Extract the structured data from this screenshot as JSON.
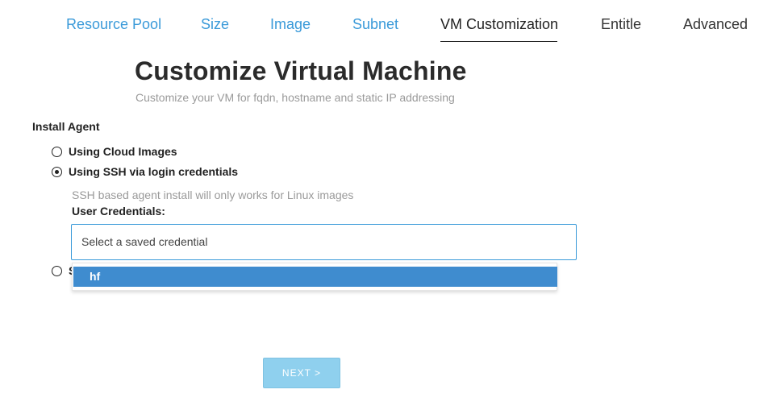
{
  "tabs": [
    {
      "label": "Resource Pool",
      "state": "link"
    },
    {
      "label": "Size",
      "state": "link"
    },
    {
      "label": "Image",
      "state": "link"
    },
    {
      "label": "Subnet",
      "state": "link"
    },
    {
      "label": "VM Customization",
      "state": "active"
    },
    {
      "label": "Entitle",
      "state": "plain"
    },
    {
      "label": "Advanced",
      "state": "plain"
    }
  ],
  "header": {
    "title": "Customize Virtual Machine",
    "subtitle": "Customize your VM for fqdn, hostname and static IP addressing"
  },
  "install_agent": {
    "label": "Install Agent",
    "options": [
      {
        "label": "Using Cloud Images",
        "selected": false
      },
      {
        "label": "Using SSH via login credentials",
        "selected": true
      },
      {
        "label": "S",
        "selected": false
      }
    ],
    "ssh_hint": "SSH based agent install will only works for Linux images",
    "credentials_label": "User Credentials:",
    "credentials_placeholder": "Select a saved credential",
    "dropdown_options": [
      "hf"
    ]
  },
  "footer": {
    "next_label": "NEXT >"
  },
  "colors": {
    "accent": "#3a9ad9",
    "highlight": "#3f8ccf",
    "next_button": "#8fd0ee"
  }
}
